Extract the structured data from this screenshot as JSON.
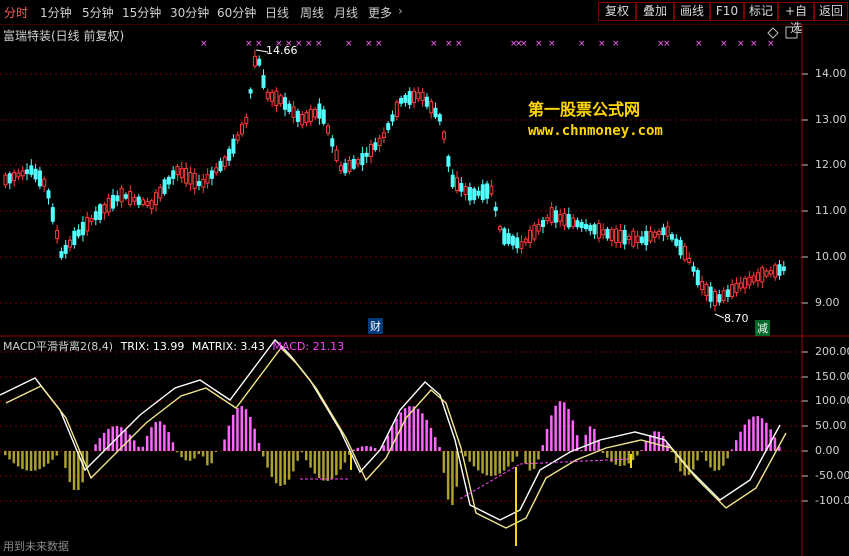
{
  "toolbar": {
    "periods": [
      "分时",
      "1分钟",
      "5分钟",
      "15分钟",
      "30分钟",
      "60分钟",
      "日线",
      "周线",
      "月线",
      "更多"
    ],
    "more_arrow": "›",
    "buttons": [
      "复权",
      "叠加",
      "画线",
      "F10",
      "标记",
      "+自选",
      "返回"
    ]
  },
  "stock": {
    "title": "富瑞特装(日线 前复权)",
    "high_label": "14.66",
    "low_label": "8.70",
    "price_axis": [
      "14.00",
      "13.00",
      "12.00",
      "11.00",
      "10.00",
      "9.00"
    ],
    "event_cai": "财",
    "event_jian": "减"
  },
  "indicator": {
    "name": "MACD平滑背离2(8,4)",
    "trix_label": "TRIX: 13.99",
    "matrix_label": "MATRIX: 3.43",
    "macd_label": "MACD: 21.13",
    "axis": [
      "200.00",
      "150.00",
      "100.00",
      "50.00",
      "0.00",
      "-50.00",
      "-100.00"
    ]
  },
  "watermark": {
    "line1": "第一股票公式网",
    "line2": "www.chnmoney.com"
  },
  "footer": {
    "note": "用到未来数据"
  },
  "colors": {
    "up": "#ff3b3b",
    "down": "#54ffff",
    "hist_pos": "#ff66ff",
    "hist_neg": "#aaa030",
    "grid": "#7a0000",
    "yellow": "#ffd700",
    "magenta": "#ff44ff"
  },
  "icons": [
    "diamond-icon",
    "close-icon"
  ]
}
